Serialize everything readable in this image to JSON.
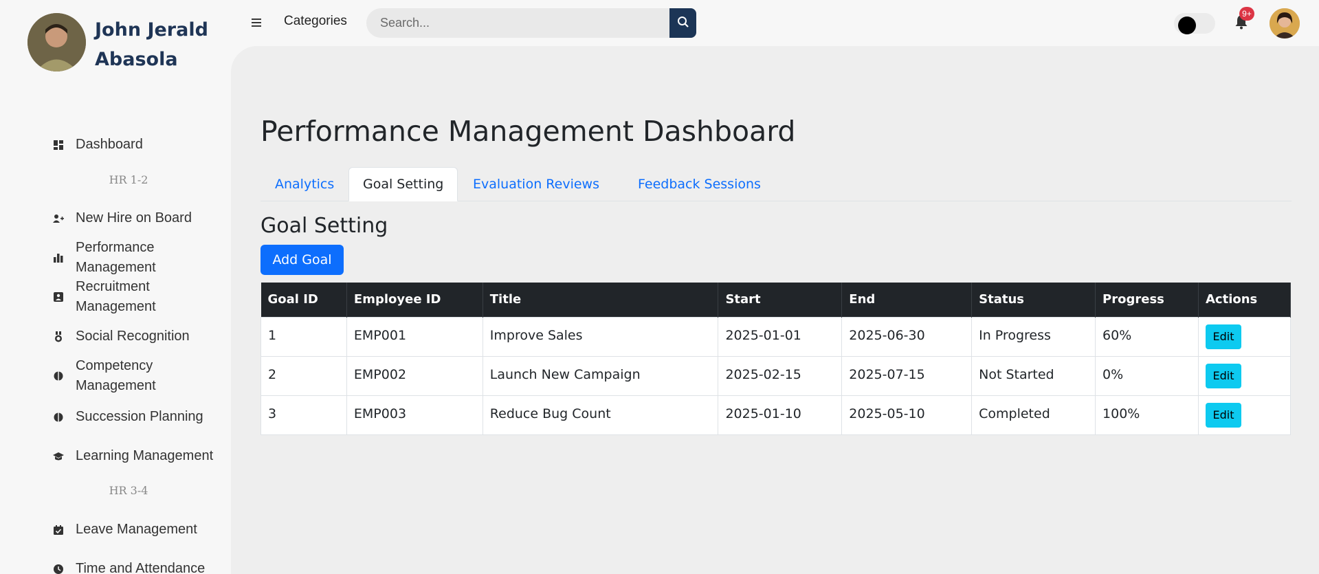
{
  "user": {
    "name": "John Jerald Abasola"
  },
  "sidebar": {
    "items": [
      {
        "label": "Dashboard",
        "icon": "dashboard-icon"
      },
      {
        "section": "HR 1-2"
      },
      {
        "label": "New Hire on Board",
        "icon": "user-plus-icon"
      },
      {
        "label": "Performance Management",
        "icon": "bar-chart-icon"
      },
      {
        "label": "Recruitment Management",
        "icon": "id-badge-icon"
      },
      {
        "label": "Social Recognition",
        "icon": "medal-icon"
      },
      {
        "label": "Competency Management",
        "icon": "half-circle-icon"
      },
      {
        "label": "Succession Planning",
        "icon": "half-circle-icon"
      },
      {
        "label": "Learning Management",
        "icon": "graduation-cap-icon"
      },
      {
        "section": "HR 3-4"
      },
      {
        "label": "Leave Management",
        "icon": "calendar-check-icon"
      },
      {
        "label": "Time and Attendance",
        "icon": "clock-icon"
      }
    ]
  },
  "topbar": {
    "categories_label": "Categories",
    "search_placeholder": "Search...",
    "notification_badge": "9+"
  },
  "main": {
    "title": "Performance Management Dashboard",
    "tabs": [
      {
        "label": "Analytics",
        "active": false
      },
      {
        "label": "Goal Setting",
        "active": true
      },
      {
        "label": "Evaluation Reviews",
        "active": false
      },
      {
        "label": "Feedback Sessions",
        "active": false
      }
    ],
    "section_title": "Goal Setting",
    "add_button": "Add Goal",
    "table": {
      "headers": [
        "Goal ID",
        "Employee ID",
        "Title",
        "Start",
        "End",
        "Status",
        "Progress",
        "Actions"
      ],
      "rows": [
        {
          "goal_id": "1",
          "employee_id": "EMP001",
          "title": "Improve Sales",
          "start": "2025-01-01",
          "end": "2025-06-30",
          "status": "In Progress",
          "progress": "60%",
          "action": "Edit"
        },
        {
          "goal_id": "2",
          "employee_id": "EMP002",
          "title": "Launch New Campaign",
          "start": "2025-02-15",
          "end": "2025-07-15",
          "status": "Not Started",
          "progress": "0%",
          "action": "Edit"
        },
        {
          "goal_id": "3",
          "employee_id": "EMP003",
          "title": "Reduce Bug Count",
          "start": "2025-01-10",
          "end": "2025-05-10",
          "status": "Completed",
          "progress": "100%",
          "action": "Edit"
        }
      ]
    }
  },
  "colors": {
    "brand": "#1c3556",
    "primary": "#0d6efd",
    "info": "#0dcaf0",
    "danger": "#dc3545",
    "table_header": "#212529"
  }
}
